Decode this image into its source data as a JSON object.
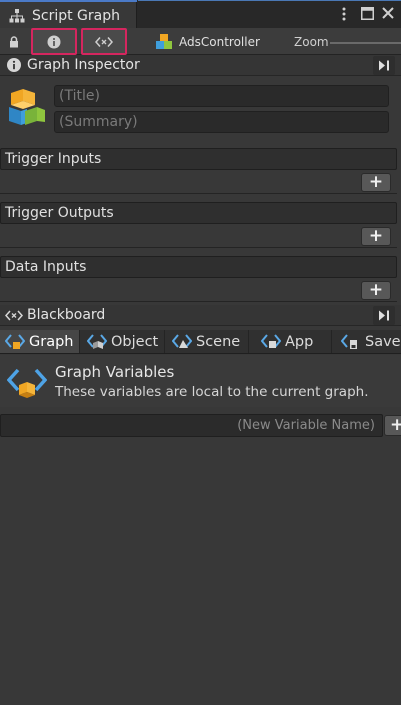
{
  "window": {
    "tab_title": "Script Graph"
  },
  "toolbar": {
    "target_object": "AdsController",
    "zoom_label": "Zoom"
  },
  "graph_inspector": {
    "title": "Graph Inspector",
    "title_placeholder": "(Title)",
    "summary_placeholder": "(Summary)"
  },
  "sections": [
    {
      "title": "Trigger Inputs",
      "add_label": "+"
    },
    {
      "title": "Trigger Outputs",
      "add_label": "+"
    },
    {
      "title": "Data Inputs",
      "add_label": "+"
    }
  ],
  "blackboard": {
    "title": "Blackboard",
    "tabs": [
      {
        "label": "Graph",
        "active": true
      },
      {
        "label": "Object",
        "active": false
      },
      {
        "label": "Scene",
        "active": false
      },
      {
        "label": "App",
        "active": false
      },
      {
        "label": "Saved",
        "active": false
      }
    ],
    "variables_title": "Graph Variables",
    "variables_description": "These variables are local to the current graph.",
    "new_variable_placeholder": "(New Variable Name)",
    "add_label": "+"
  },
  "colors": {
    "background": "#383838",
    "highlight_border": "#d5265f",
    "tab_accent": "#4b7ac7"
  }
}
